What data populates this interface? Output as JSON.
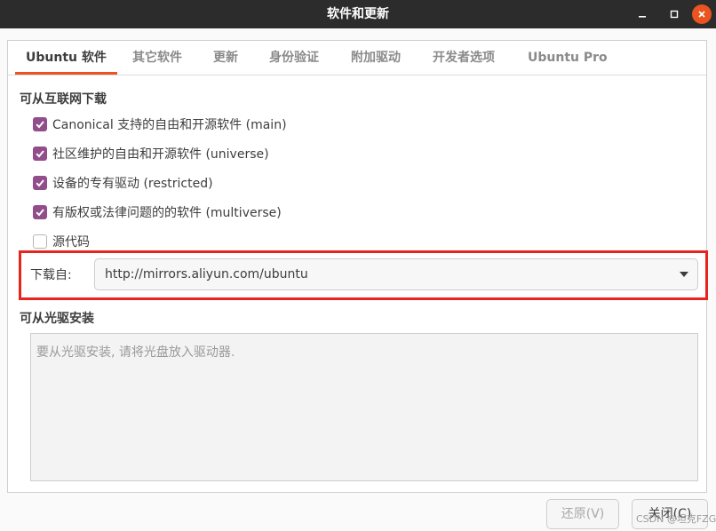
{
  "window": {
    "title": "软件和更新",
    "minimize_icon": "minimize-icon",
    "maximize_icon": "maximize-icon",
    "close_icon": "close-icon",
    "close_color": "#e95420"
  },
  "tabs": [
    {
      "label": "Ubuntu 软件",
      "active": true
    },
    {
      "label": "其它软件",
      "active": false
    },
    {
      "label": "更新",
      "active": false
    },
    {
      "label": "身份验证",
      "active": false
    },
    {
      "label": "附加驱动",
      "active": false
    },
    {
      "label": "开发者选项",
      "active": false
    },
    {
      "label": "Ubuntu Pro",
      "active": false
    }
  ],
  "internet": {
    "heading": "可从互联网下载",
    "options": [
      {
        "label": "Canonical 支持的自由和开源软件 (main)",
        "checked": true
      },
      {
        "label": "社区维护的自由和开源软件 (universe)",
        "checked": true
      },
      {
        "label": "设备的专有驱动 (restricted)",
        "checked": true
      },
      {
        "label": "有版权或法律问题的的软件 (multiverse)",
        "checked": true
      },
      {
        "label": "源代码",
        "checked": false
      }
    ],
    "download_from_label": "下载自:",
    "download_from_value": "http://mirrors.aliyun.com/ubuntu"
  },
  "cdrom": {
    "heading": "可从光驱安装",
    "placeholder": "要从光驱安装, 请将光盘放入驱动器."
  },
  "buttons": {
    "revert": "还原(V)",
    "close": "关闭(C)"
  },
  "watermark": "CSDN @坦克FZG",
  "colors": {
    "accent": "#e95420",
    "checkbox": "#924d8b",
    "highlight_box": "#e8241f"
  }
}
